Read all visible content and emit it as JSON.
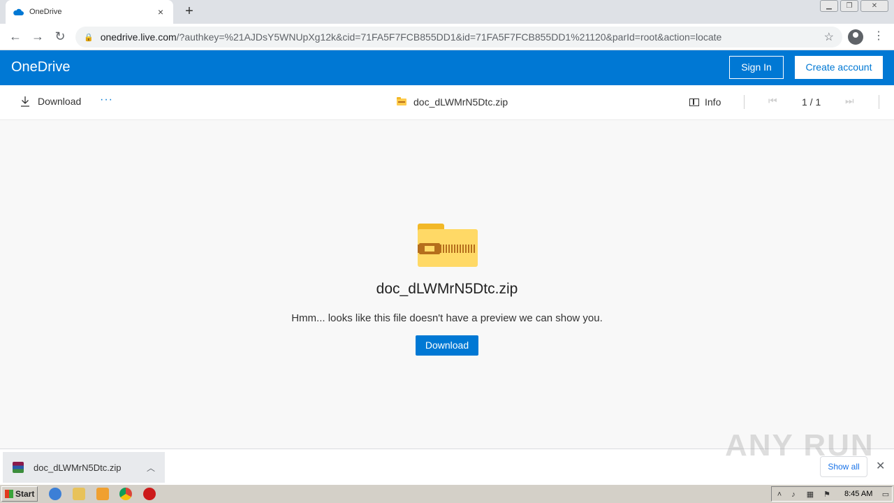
{
  "browser": {
    "tab_title": "OneDrive",
    "tab_close": "×",
    "new_tab": "+",
    "url_host": "onedrive.live.com",
    "url_path": "/?authkey=%21AJDsY5WNUpXg12k&cid=71FA5F7FCB855DD1&id=71FA5F7FCB855DD1%21120&parId=root&action=locate"
  },
  "header": {
    "brand": "OneDrive",
    "sign_in": "Sign In",
    "create_account": "Create account"
  },
  "commandbar": {
    "download": "Download",
    "more": "···",
    "file_name": "doc_dLWMrN5Dtc.zip",
    "info": "Info",
    "page_count": "1 / 1"
  },
  "preview": {
    "file_name": "doc_dLWMrN5Dtc.zip",
    "message": "Hmm... looks like this file doesn't have a preview we can show you.",
    "download_button": "Download"
  },
  "shelf": {
    "file_name": "doc_dLWMrN5Dtc.zip",
    "show_all": "Show all",
    "watermark": "ANY RUN"
  },
  "taskbar": {
    "start": "Start",
    "time": "8:45 AM"
  },
  "colors": {
    "onedrive_blue": "#0078d4",
    "folder_yellow": "#ffd966"
  }
}
